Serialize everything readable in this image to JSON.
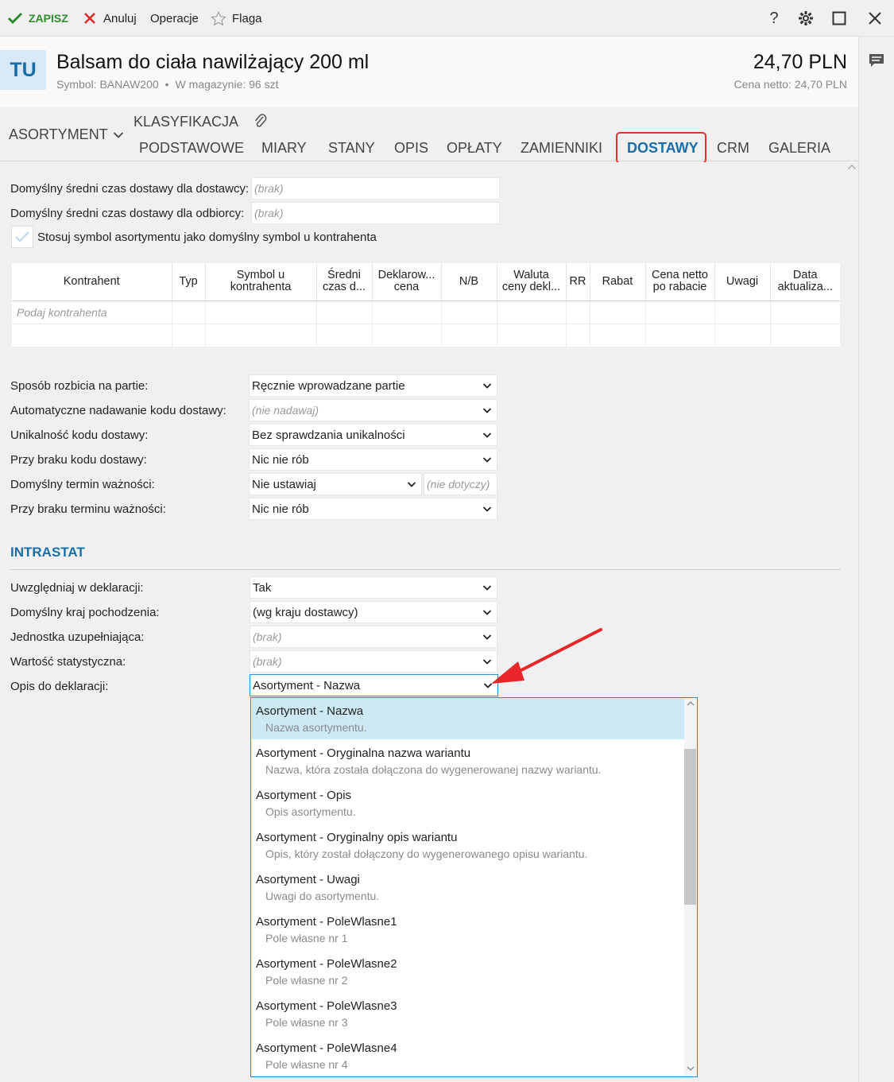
{
  "toolbar": {
    "save_label": "ZAPISZ",
    "cancel_label": "Anuluj",
    "operations_label": "Operacje",
    "flag_label": "Flaga",
    "help_label": "?"
  },
  "header": {
    "avatar": "TU",
    "title": "Balsam do ciała nawilżający 200 ml",
    "symbol": "Symbol: BANAW200",
    "stock": "W magazynie: 96 szt",
    "separator": "•",
    "price": "24,70 PLN",
    "net_price": "Cena netto: 24,70 PLN"
  },
  "tabs": {
    "group_label": "ASORTYMENT",
    "top": [
      "KLASYFIKACJA"
    ],
    "items": [
      "PODSTAWOWE",
      "MIARY",
      "STANY",
      "OPIS",
      "OPŁATY",
      "ZAMIENNIKI",
      "DOSTAWY",
      "CRM",
      "GALERIA"
    ],
    "active": "DOSTAWY"
  },
  "delivery": {
    "supplier_time_label": "Domyślny średni czas dostawy dla dostawcy:",
    "supplier_time_value": "(brak)",
    "customer_time_label": "Domyślny średni czas dostawy dla odbiorcy:",
    "customer_time_value": "(brak)",
    "use_symbol_label": "Stosuj symbol asortymentu jako domyślny symbol u kontrahenta"
  },
  "grid": {
    "columns": [
      [
        "Kontrahent"
      ],
      [
        "Typ"
      ],
      [
        "Symbol u",
        "kontrahenta"
      ],
      [
        "Średni",
        "czas d..."
      ],
      [
        "Deklarow...",
        "cena"
      ],
      [
        "N/B"
      ],
      [
        "Waluta",
        "ceny dekl..."
      ],
      [
        "RR"
      ],
      [
        "Rabat"
      ],
      [
        "Cena netto",
        "po rabacie"
      ],
      [
        "Uwagi"
      ],
      [
        "Data",
        "aktualiza..."
      ]
    ],
    "placeholder": "Podaj kontrahenta"
  },
  "batches": {
    "split_label": "Sposób rozbicia na partie:",
    "split_value": "Ręcznie wprowadzane partie",
    "autocode_label": "Automatyczne nadawanie kodu dostawy:",
    "autocode_value": "(nie nadawaj)",
    "unique_label": "Unikalność kodu dostawy:",
    "unique_value": "Bez sprawdzania unikalności",
    "nocode_label": "Przy braku kodu dostawy:",
    "nocode_value": "Nic nie rób",
    "expiry_label": "Domyślny termin ważności:",
    "expiry_value": "Nie ustawiaj",
    "expiry_extra": "(nie dotyczy)",
    "noexpiry_label": "Przy braku terminu ważności:",
    "noexpiry_value": "Nic nie rób"
  },
  "intrastat": {
    "title": "INTRASTAT",
    "include_label": "Uwzględniaj w deklaracji:",
    "include_value": "Tak",
    "origin_label": "Domyślny kraj pochodzenia:",
    "origin_value": "(wg kraju dostawcy)",
    "unit_label": "Jednostka uzupełniająca:",
    "unit_value": "(brak)",
    "stat_label": "Wartość statystyczna:",
    "stat_value": "(brak)",
    "desc_label": "Opis do deklaracji:",
    "desc_value": "Asortyment - Nazwa"
  },
  "dropdown": {
    "options": [
      {
        "title": "Asortyment - Nazwa",
        "desc": "Nazwa asortymentu."
      },
      {
        "title": "Asortyment - Oryginalna nazwa wariantu",
        "desc": "Nazwa, która została dołączona do wygenerowanej nazwy wariantu."
      },
      {
        "title": "Asortyment - Opis",
        "desc": "Opis asortymentu."
      },
      {
        "title": "Asortyment - Oryginalny opis wariantu",
        "desc": "Opis, który został dołączony do wygenerowanego opisu wariantu."
      },
      {
        "title": "Asortyment - Uwagi",
        "desc": "Uwagi do asortymentu."
      },
      {
        "title": "Asortyment - PoleWlasne1",
        "desc": "Pole własne nr 1"
      },
      {
        "title": "Asortyment - PoleWlasne2",
        "desc": "Pole własne nr 2"
      },
      {
        "title": "Asortyment - PoleWlasne3",
        "desc": "Pole własne nr 3"
      },
      {
        "title": "Asortyment - PoleWlasne4",
        "desc": "Pole własne nr 4"
      }
    ],
    "selected_index": 0
  },
  "colors": {
    "accent": "#1a6ea8",
    "save_green": "#2e8b2e",
    "highlight_red": "#e52e2e",
    "selection": "#cde9f6"
  }
}
